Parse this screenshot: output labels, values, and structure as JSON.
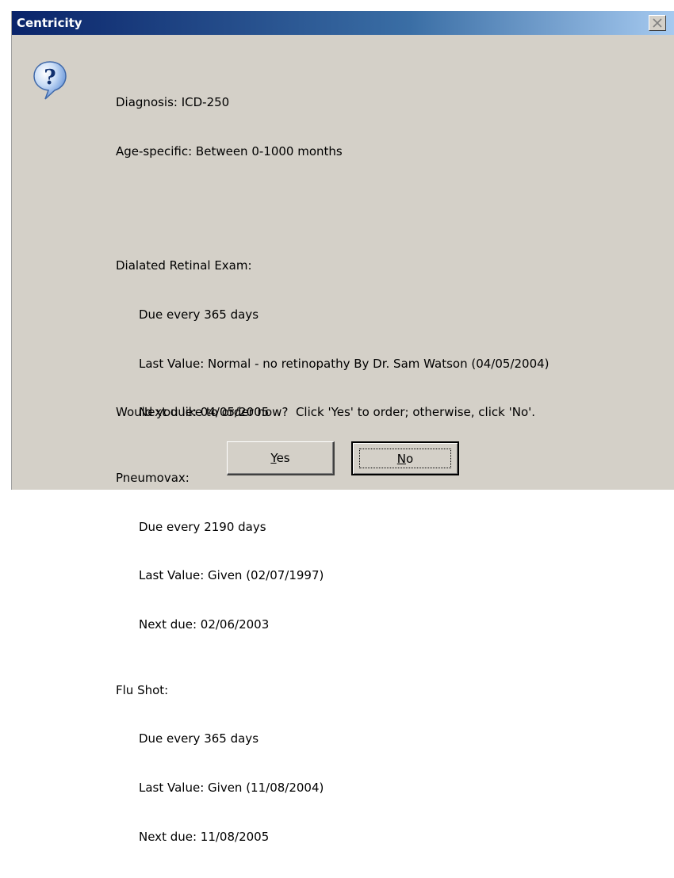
{
  "window": {
    "title": "Centricity",
    "close_icon": "close-icon"
  },
  "icon": "question-icon",
  "message": {
    "diagnosis": "Diagnosis: ICD-250",
    "age": "Age-specific: Between 0-1000 months",
    "items": [
      {
        "name": "Dialated Retinal Exam:",
        "due": "Due every 365 days",
        "last": "Last Value: Normal - no retinopathy By Dr. Sam Watson (04/05/2004)",
        "next": "Next due: 04/05/2005"
      },
      {
        "name": "Pneumovax:",
        "due": "Due every 2190 days",
        "last": "Last Value: Given (02/07/1997)",
        "next": "Next due: 02/06/2003"
      },
      {
        "name": "Flu Shot:",
        "due": "Due every 365 days",
        "last": "Last Value: Given (11/08/2004)",
        "next": "Next due: 11/08/2005"
      }
    ],
    "prompt": "Would you like to order now?  Click 'Yes' to order; otherwise, click 'No'."
  },
  "buttons": {
    "yes": {
      "accel": "Y",
      "rest": "es"
    },
    "no": {
      "accel": "N",
      "rest": "o"
    }
  }
}
